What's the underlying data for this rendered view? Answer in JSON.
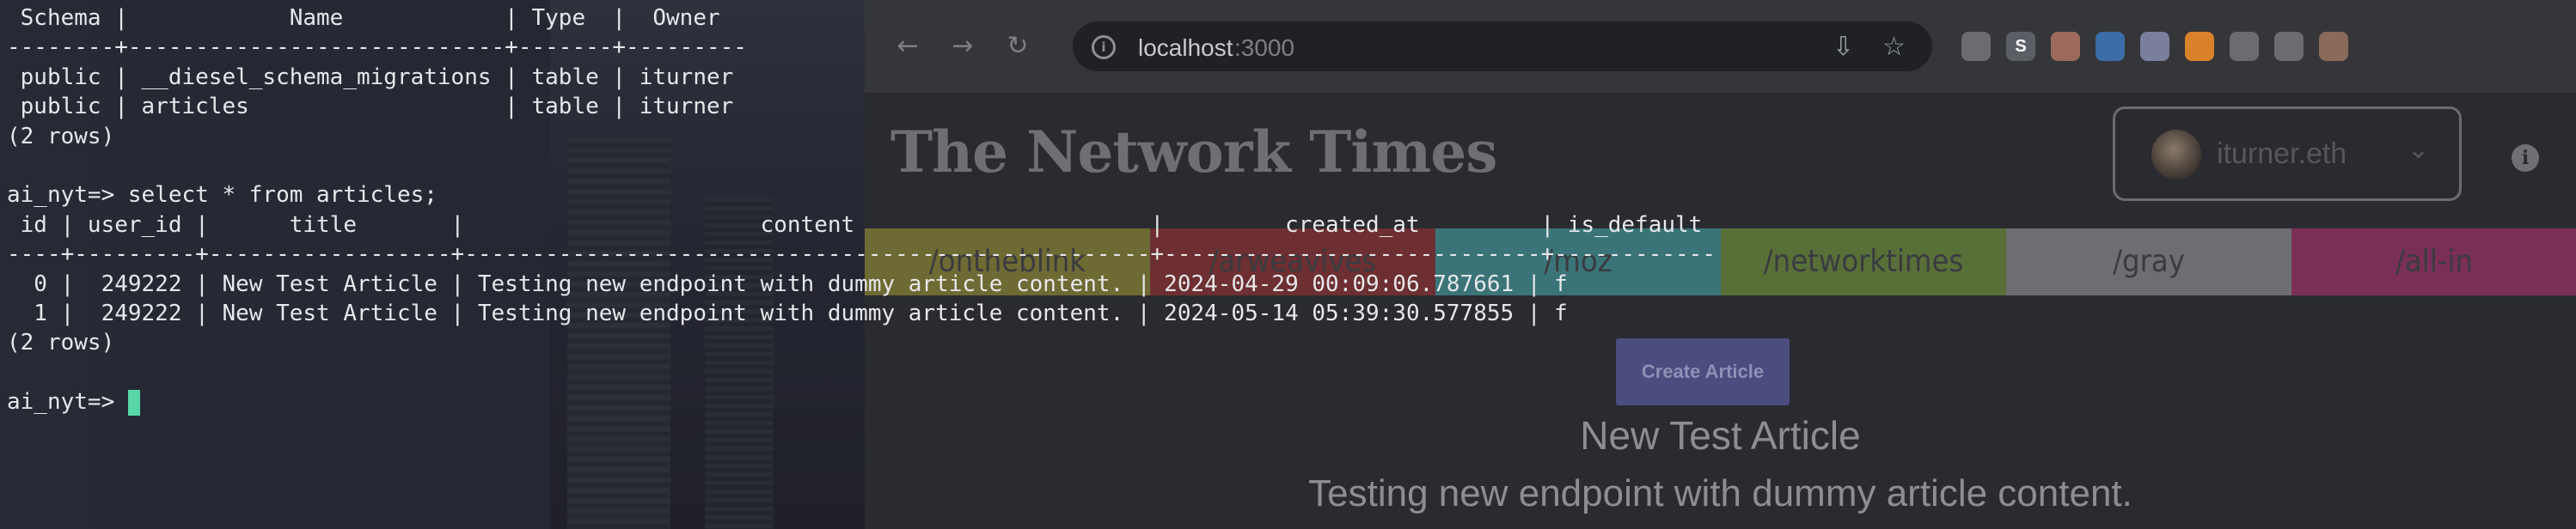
{
  "browser": {
    "url_host": "localhost",
    "url_port": ":3000",
    "icons": {
      "back": "arrow-left-icon",
      "forward": "arrow-right-icon",
      "reload": "reload-icon",
      "site_info": "info-icon",
      "install": "install-app-icon",
      "bookmark": "star-icon"
    },
    "extensions": [
      {
        "name": "extension-1-icon",
        "label": "",
        "color": "#6b6c70"
      },
      {
        "name": "extension-s-icon",
        "label": "S",
        "color": "#5c5e66"
      },
      {
        "name": "extension-3-icon",
        "label": "",
        "color": "#9b6a5c"
      },
      {
        "name": "extension-4-icon",
        "label": "",
        "color": "#3b6ea8"
      },
      {
        "name": "extension-5-icon",
        "label": "",
        "color": "#7a7f9e"
      },
      {
        "name": "metamask-icon",
        "label": "",
        "color": "#d9822b"
      },
      {
        "name": "puzzle-icon",
        "label": "",
        "color": "#6b6c70"
      },
      {
        "name": "reading-list-icon",
        "label": "",
        "color": "#6b6c70"
      },
      {
        "name": "profile-icon",
        "label": "",
        "color": "#8a6a5a"
      }
    ]
  },
  "site": {
    "masthead": "The Network Times",
    "account_name": "iturner.eth",
    "account_chevron": "chevron-down-icon",
    "channels": [
      {
        "label": "/ontheblink",
        "color": "#6e6a33"
      },
      {
        "label": "/arweavives",
        "color": "#6d2f31"
      },
      {
        "label": "/moz",
        "color": "#3a7478"
      },
      {
        "label": "/networktimes",
        "color": "#586f38"
      },
      {
        "label": "/gray",
        "color": "#6d6e71"
      },
      {
        "label": "/all-in",
        "color": "#7a2f56"
      }
    ],
    "create_button": "Create Article",
    "article": {
      "title": "New Test Article",
      "content": "Testing new endpoint with dummy article content."
    }
  },
  "terminal": {
    "lines": [
      " Schema |            Name            | Type  |  Owner",
      "--------+----------------------------+-------+---------",
      " public | __diesel_schema_migrations | table | iturner",
      " public | articles                   | table | iturner",
      "(2 rows)",
      "",
      "ai_nyt=> select * from articles;",
      " id | user_id |      title       |                      content                      |         created_at         | is_default",
      "----+---------+------------------+---------------------------------------------------+----------------------------+------------",
      "  0 |  249222 | New Test Article | Testing new endpoint with dummy article content. | 2024-04-29 00:09:06.787661 | f",
      "  1 |  249222 | New Test Article | Testing new endpoint with dummy article content. | 2024-05-14 05:39:30.577855 | f",
      "(2 rows)",
      ""
    ],
    "prompt": "ai_nyt=> "
  }
}
